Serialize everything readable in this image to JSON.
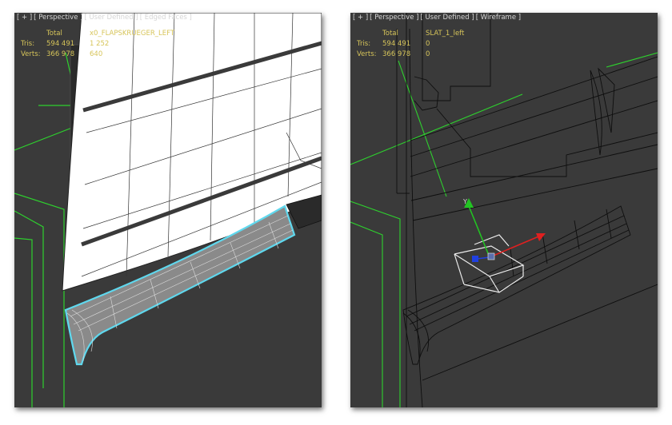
{
  "left_viewport": {
    "label": {
      "plus": "[ + ]",
      "view": "[ Perspective ]",
      "shading_mode": "[ User Defined ]",
      "edges": "[ Edged Faces ]"
    },
    "stats": {
      "header_total": "Total",
      "header_object": "x0_FLAPSKRUEGER_LEFT",
      "tris_label": "Tris:",
      "tris_total": "594 491",
      "tris_object": "1 252",
      "verts_label": "Verts:",
      "verts_total": "366 978",
      "verts_object": "640"
    }
  },
  "right_viewport": {
    "label": {
      "plus": "[ + ]",
      "view": "[ Perspective ]",
      "shading_mode": "[ User Defined ]",
      "edges": "[ Wireframe ]"
    },
    "stats": {
      "header_total": "Total",
      "header_object": "SLAT_1_left",
      "tris_label": "Tris:",
      "tris_total": "594 491",
      "tris_object": "0",
      "verts_label": "Verts:",
      "verts_total": "366 978",
      "verts_object": "0"
    },
    "gizmo_axis_label": "Y"
  },
  "colors": {
    "viewport_bg": "#3a3a3a",
    "grid_green": "#2ed12e",
    "selection_cyan": "#5fd8ee",
    "label_text": "#d6d6d6",
    "stats_text": "#d7c55a",
    "gizmo_x": "#e02020",
    "gizmo_y": "#22c422",
    "gizmo_z": "#2040e0"
  }
}
